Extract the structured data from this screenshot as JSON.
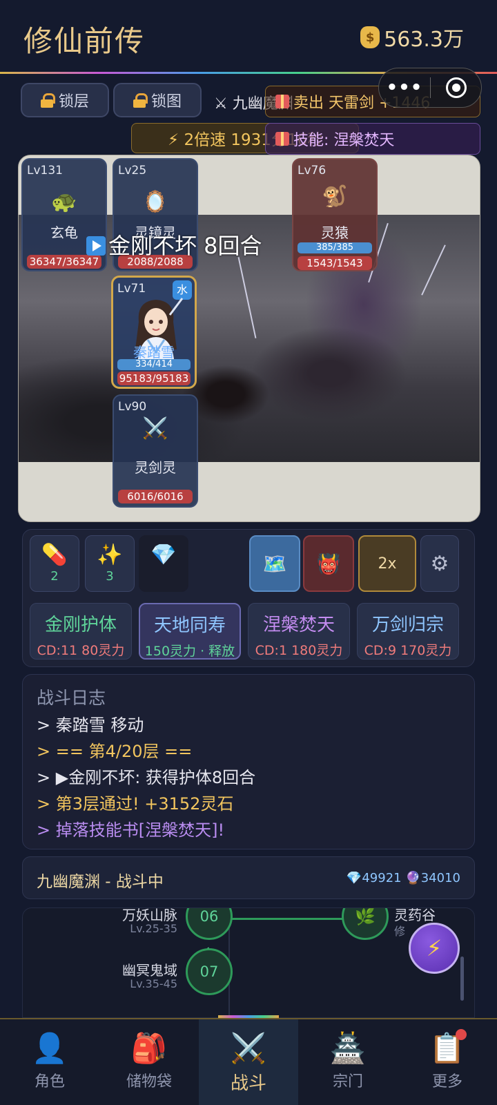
{
  "header": {
    "title": "修仙前传",
    "gold": "563.3万",
    "gold_icon": "money-bag-icon"
  },
  "toolbar": {
    "lock_layer": "锁层",
    "lock_map": "锁图",
    "zone_name": "九幽魔渊",
    "speed": "⚡ 2倍速 1931分16秒"
  },
  "toasts": [
    {
      "text": "卖出 天雷剑 +1446"
    },
    {
      "text": "技能: 涅槃焚天"
    }
  ],
  "battle": {
    "buff_text": "金刚不坏 8回合",
    "units": [
      {
        "lv": "Lv131",
        "icon": "🐢",
        "name": "玄龟",
        "hp": "36347/36347"
      },
      {
        "lv": "Lv25",
        "icon": "🪞",
        "name": "灵镜灵",
        "hp": "2088/2088"
      },
      {
        "lv": "Lv76",
        "icon": "🐒",
        "name": "灵猿",
        "mp": "385/385",
        "hp": "1543/1543"
      },
      {
        "lv": "Lv71",
        "name": "秦踏雪",
        "element": "水",
        "mp": "334/414",
        "hp": "95183/95183"
      },
      {
        "lv": "Lv90",
        "icon": "⚔️",
        "name": "灵剑灵",
        "hp": "6016/6016"
      }
    ]
  },
  "items": [
    {
      "icon": "💊",
      "count": "2"
    },
    {
      "icon": "✨",
      "count": "3"
    },
    {
      "icon": "💎",
      "count": ""
    }
  ],
  "tools": {
    "map": "🗺️",
    "demon": "👹",
    "speed2x": "2x",
    "settings": "⚙"
  },
  "skills": [
    {
      "name": "金刚护体",
      "cost": "CD:11  80灵力",
      "color": "#5fd49a"
    },
    {
      "name": "天地同寿",
      "cost": "150灵力 · 释放",
      "color": "#8fc6ff"
    },
    {
      "name": "涅槃焚天",
      "cost": "CD:1  180灵力",
      "color": "#c38cf0"
    },
    {
      "name": "万剑归宗",
      "cost": "CD:9  170灵力",
      "color": "#8fc6ff"
    }
  ],
  "log": {
    "title": "战斗日志",
    "lines": [
      {
        "text": "> 秦踏雪 移动",
        "color": "#e6e6ee"
      },
      {
        "text": "> == 第4/20层 ==",
        "color": "#f2c55e"
      },
      {
        "text": "> ▶金刚不坏: 获得护体8回合",
        "color": "#e6e6ee"
      },
      {
        "text": "> 第3层通过! +3152灵石",
        "color": "#f2c55e"
      },
      {
        "text": "> 掉落技能书[涅槃焚天]!",
        "color": "#b98cf0"
      }
    ]
  },
  "status": {
    "text": "九幽魔渊 - 战斗中",
    "resources": "💎49921 🔮34010"
  },
  "map": {
    "nodes": [
      {
        "num": "06",
        "name": "万妖山脉",
        "lv": "Lv.25-35"
      },
      {
        "num": "07",
        "name": "幽冥鬼域",
        "lv": "Lv.35-45"
      }
    ],
    "side_name": "灵药谷",
    "side_lv": "修",
    "check": "✓"
  },
  "nav": [
    {
      "icon": "👤",
      "label": "角色"
    },
    {
      "icon": "🎒",
      "label": "储物袋"
    },
    {
      "icon": "⚔️",
      "label": "战斗"
    },
    {
      "icon": "🏯",
      "label": "宗门"
    },
    {
      "icon": "📋",
      "label": "更多"
    }
  ]
}
